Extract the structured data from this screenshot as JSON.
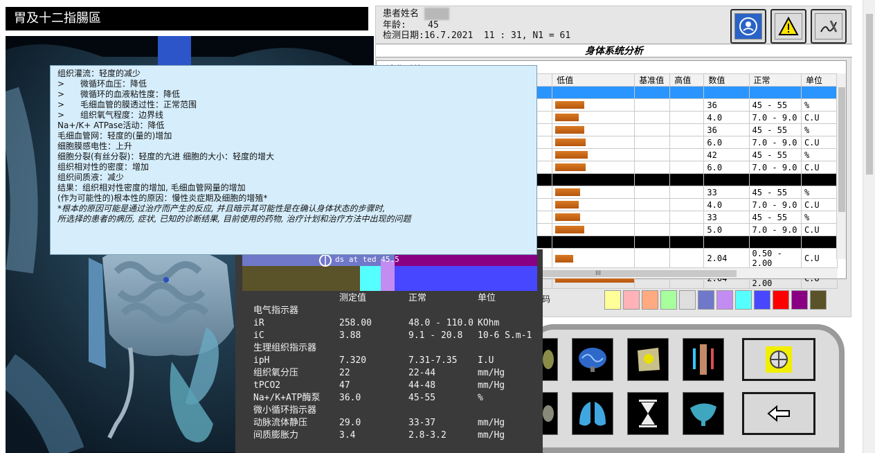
{
  "left": {
    "title": "胃及十二指腸區"
  },
  "patient": {
    "name_label": "患者姓名",
    "age_label": "年龄:",
    "age": "45",
    "date_label": "检测日期:",
    "date_value": "16.7.2021  11 : 31, N1 = 61"
  },
  "toolbar": {
    "icons": [
      "baby-care-icon",
      "warning-icon",
      "signature-icon"
    ]
  },
  "analysis": {
    "title": "身体系统分析",
    "system_label": "消化系统",
    "headers": [
      "低值",
      "基准值",
      "高值",
      "数值",
      "正常",
      "单位"
    ],
    "rows": [
      {
        "type": "selected",
        "value": "",
        "normal": "",
        "unit": ""
      },
      {
        "type": "data",
        "bar": 0.8,
        "value": "36",
        "normal": "45 - 55",
        "unit": "%"
      },
      {
        "type": "data",
        "bar": 0.65,
        "value": "4.0",
        "normal": "7.0 - 9.0",
        "unit": "C.U"
      },
      {
        "type": "data",
        "bar": 0.8,
        "value": "36",
        "normal": "45 - 55",
        "unit": "%"
      },
      {
        "type": "data",
        "bar": 0.85,
        "value": "6.0",
        "normal": "7.0 - 9.0",
        "unit": "C.U"
      },
      {
        "type": "data",
        "bar": 0.9,
        "value": "42",
        "normal": "45 - 55",
        "unit": "%"
      },
      {
        "type": "data",
        "bar": 0.85,
        "value": "6.0",
        "normal": "7.0 - 9.0",
        "unit": "C.U"
      },
      {
        "type": "black",
        "value": "",
        "normal": "",
        "unit": ""
      },
      {
        "type": "data",
        "bar": 0.7,
        "value": "33",
        "normal": "45 - 55",
        "unit": "%"
      },
      {
        "type": "data",
        "bar": 0.65,
        "value": "4.0",
        "normal": "7.0 - 9.0",
        "unit": "C.U"
      },
      {
        "type": "data",
        "bar": 0.7,
        "value": "33",
        "normal": "45 - 55",
        "unit": "%"
      },
      {
        "type": "data",
        "bar": 0.8,
        "value": "5.0",
        "normal": "7.0 - 9.0",
        "unit": "C.U"
      },
      {
        "type": "black",
        "value": "",
        "normal": "",
        "unit": ""
      },
      {
        "type": "data",
        "bar": 0.5,
        "value": "2.04",
        "normal": "0.50 - 2.00",
        "unit": "C.U"
      },
      {
        "type": "data",
        "bar": 2.2,
        "value": "2.04",
        "normal": "0.50 - 2.00",
        "unit": "C.U"
      }
    ],
    "legend_label": "码",
    "swatches": [
      "#ffff99",
      "#ffb3b8",
      "#ffaa80",
      "#a6ff9c",
      "#dedede",
      "#7078c9",
      "#c38cf2",
      "#55ffff",
      "#4747ff",
      "#ff0000",
      "#8a0082",
      "#5a5228"
    ]
  },
  "tooltip": {
    "lines": [
      "组织灌流：轻度的减少",
      ">      微循环血压：降低",
      ">      微循环的血液粘性度：降低",
      ">      毛细血管的膜透过性：正常范围",
      ">      组织氧气程度：边界线",
      "Na+/K+ ATPase活动：降低",
      "毛细血管网：轻度的(量的)增加",
      "细胞膜感电性：上升",
      "细胞分裂(有丝分裂)：轻度的亢进 细胞的大小：轻度的增大",
      "组织相对性的密度：增加",
      "组织间质液：减少",
      "结果：组织相对性密度的增加, 毛细血管网量的增加",
      "(作为可能性的)根本性的原因：慢性炎症期及细胞的增殖*"
    ],
    "italic_lines": [
      "*根本的原因可能是通过治疗而产生的反应, 并且暗示其可能性是在确认身体状态的步骤时,",
      "所选择的患者的病历, 症状, 已知的诊断结果, 目前使用的药物, 治疗计划和治疗方法中出现的问题"
    ]
  },
  "measure": {
    "headers": {
      "measured": "测定值",
      "normal": "正常",
      "unit": "单位"
    },
    "overlay_text": "ds      at ted    45.5",
    "rows": [
      {
        "name": "电气指示器",
        "value": "",
        "normal": "",
        "unit": ""
      },
      {
        "name": "iR",
        "value": "258.00",
        "normal": "48.0 - 110.0",
        "unit": "KOhm"
      },
      {
        "name": "iC",
        "value": "3.88",
        "normal": "9.1 - 20.8",
        "unit": "10-6 S.m-1"
      },
      {
        "name": "生理组织指示器",
        "value": "",
        "normal": "",
        "unit": ""
      },
      {
        "name": "ipH",
        "value": "7.320",
        "normal": "7.31-7.35",
        "unit": "I.U"
      },
      {
        "name": "组织氧分压",
        "value": "22",
        "normal": "22-44",
        "unit": "mm/Hg"
      },
      {
        "name": "tPCO2",
        "value": "47",
        "normal": "44-48",
        "unit": "mm/Hg"
      },
      {
        "name": "Na+/K+ATP酶泵",
        "value": "36.0",
        "normal": "45-55",
        "unit": "%"
      },
      {
        "name": "微小循环指示器",
        "value": "",
        "normal": "",
        "unit": ""
      },
      {
        "name": "动脉流体静压",
        "value": "29.0",
        "normal": "33-37",
        "unit": "mm/Hg"
      },
      {
        "name": "间质膨胀力",
        "value": "3.4",
        "normal": "2.8-3.2",
        "unit": "mm/Hg"
      }
    ]
  },
  "buttons": {
    "organs": [
      "kidney-icon",
      "brain-icon",
      "spine-icon",
      "spinal-column-icon",
      "stomach-icon",
      "lungs-icon",
      "hourglass-icon",
      "liver-icon"
    ],
    "nav": [
      "target-icon",
      "back-arrow-icon"
    ]
  }
}
